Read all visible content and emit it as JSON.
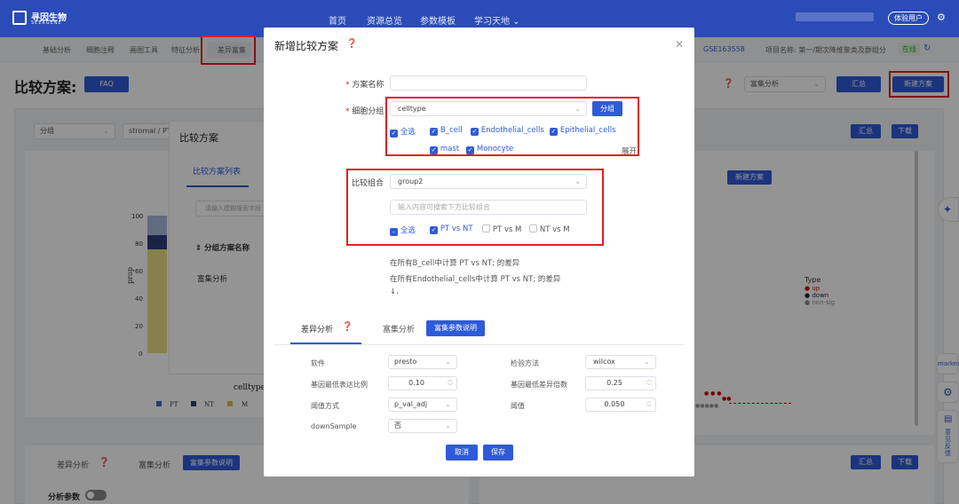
{
  "brand": {
    "name": "寻因生物",
    "sub": "SEEKGENE"
  },
  "nav": {
    "items": [
      "首页",
      "资源总览",
      "参数模板",
      "学习天地 ⌄"
    ],
    "trial": "体验用户"
  },
  "tabs": [
    "基础分析",
    "细胞注释",
    "画图工具",
    "特征分析",
    "差异富集"
  ],
  "project": {
    "label": "GSE163558",
    "analysis": "项目名称: 第一/期次降维聚类及群组分",
    "status": "在线"
  },
  "page": {
    "title": "比较方案:",
    "faq": "FAQ",
    "dropdown": "富集分析",
    "summary": "汇总",
    "new": "新建方案"
  },
  "bg": {
    "filter1": "分组",
    "filter2": "stromal / PT",
    "summary": "汇总",
    "download": "下载",
    "panel_title": "比较方案",
    "panel_tab": "比较方案列表",
    "search_ph": "请输入模糊搜索字段",
    "col": "分组方案名称",
    "row": "富集分析",
    "yaxis_label": "prop",
    "yticks": [
      "100",
      "80",
      "60",
      "40",
      "20",
      "0"
    ],
    "xaxis_label": "celltype",
    "legend": [
      "PT",
      "NT",
      "M"
    ],
    "new_plan": "新建方案",
    "type_legend": {
      "title": "Type",
      "items": [
        "up",
        "down",
        "non-sig"
      ]
    },
    "bottom_tabs": [
      "差异分析",
      "富集分析"
    ],
    "bottom_btn": "富集参数说明",
    "param_label": "分析参数",
    "side": {
      "marker": "marker",
      "feedback": "意见反馈"
    }
  },
  "modal": {
    "title": "新增比较方案",
    "name_label": "方案名称",
    "cell_group_label": "细胞分组",
    "cell_group_value": "celltype",
    "group_btn": "分组",
    "select_all": "全选",
    "cells": [
      "B_cell",
      "Endothelial_cells",
      "Epithelial_cells",
      "mast",
      "Monocyte"
    ],
    "expand": "展开",
    "compare_label": "比较组合",
    "compare_value": "group2",
    "compare_placeholder": "输入内容可搜索下方比较组合",
    "compare_opts": [
      {
        "t": "PT vs NT",
        "on": true
      },
      {
        "t": "PT vs M",
        "on": false
      },
      {
        "t": "NT vs M",
        "on": false
      }
    ],
    "info": [
      "在所有B_cell中计算 PT vs NT; 的差异",
      "在所有Endothelial_cells中计算 PT vs NT; 的差异",
      "↓."
    ],
    "tabs": {
      "diff": "差异分析",
      "enrich": "富集分析",
      "param_btn": "富集参数说明"
    },
    "form": {
      "software_l": "软件",
      "software_v": "presto",
      "method_l": "检验方法",
      "method_v": "wilcox",
      "minpct_l": "基因最低表达比例",
      "minpct_v": "0.10",
      "minfc_l": "基因最低差异倍数",
      "minfc_v": "0.25",
      "thr_l": "阈值方式",
      "thr_v": "p_val_adj",
      "val_l": "阈值",
      "val_v": "0.050",
      "ds_l": "downSample",
      "ds_v": "否"
    },
    "cancel": "取消",
    "save": "保存"
  }
}
